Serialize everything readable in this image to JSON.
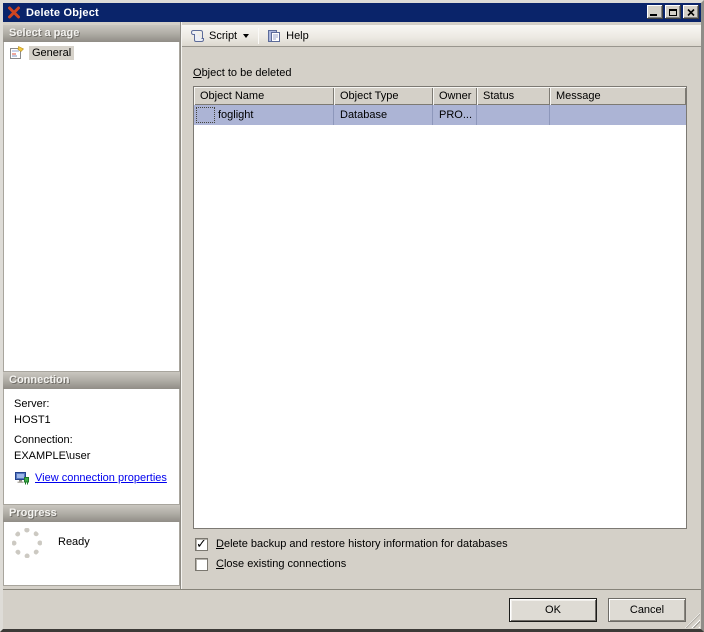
{
  "window": {
    "title": "Delete Object"
  },
  "toolbar": {
    "script_label": "Script",
    "help_label": "Help"
  },
  "sidebar": {
    "pages": {
      "header": "Select a page",
      "items": [
        {
          "label": "General",
          "selected": true
        }
      ]
    },
    "connection": {
      "header": "Connection",
      "server_label": "Server:",
      "server_value": "HOST1",
      "connection_label": "Connection:",
      "connection_value": "EXAMPLE\\user",
      "link_label": "View connection properties"
    },
    "progress": {
      "header": "Progress",
      "status": "Ready"
    }
  },
  "main": {
    "section_label": {
      "mnemonic": "O",
      "rest": "bject to be deleted"
    },
    "table": {
      "columns": [
        "Object Name",
        "Object Type",
        "Owner",
        "Status",
        "Message"
      ],
      "rows": [
        {
          "object_name": "foglight",
          "object_type": "Database",
          "owner": "PRO...",
          "status": "",
          "message": ""
        }
      ]
    },
    "checkboxes": [
      {
        "mnemonic": "D",
        "rest": "elete backup and restore history information for databases",
        "checked": true
      },
      {
        "mnemonic": "C",
        "rest": "lose existing connections",
        "checked": false
      }
    ]
  },
  "footer": {
    "ok_label": "OK",
    "cancel_label": "Cancel"
  },
  "icons": {
    "check": "✓"
  },
  "colors": {
    "titlebar": "#0a246a",
    "dialog_bg": "#d4d0c8",
    "selected_row": "#acb4d5",
    "link": "#0000ee"
  }
}
